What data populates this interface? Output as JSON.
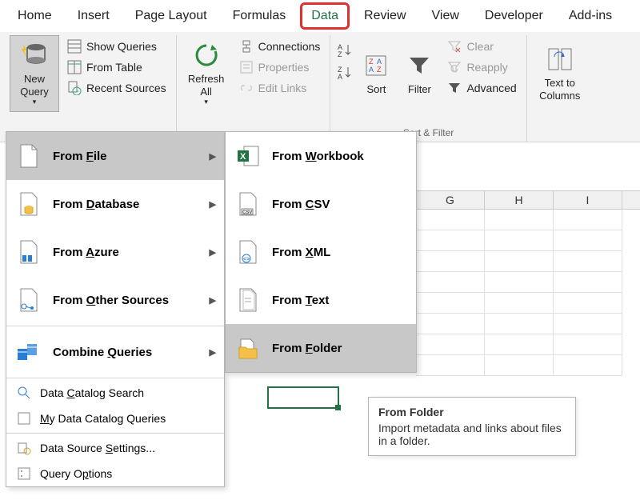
{
  "tabs": {
    "home": "Home",
    "insert": "Insert",
    "page_layout": "Page Layout",
    "formulas": "Formulas",
    "data": "Data",
    "review": "Review",
    "view": "View",
    "developer": "Developer",
    "addins": "Add-ins"
  },
  "ribbon": {
    "new_query": "New Query",
    "show_queries": "Show Queries",
    "from_table": "From Table",
    "recent_sources": "Recent Sources",
    "refresh_all": "Refresh All",
    "connections": "Connections",
    "properties": "Properties",
    "edit_links": "Edit Links",
    "sort": "Sort",
    "filter": "Filter",
    "clear": "Clear",
    "reapply": "Reapply",
    "advanced": "Advanced",
    "sort_filter_group": "Sort & Filter",
    "text_to_columns": "Text to Columns"
  },
  "menu": {
    "from_file": "From File",
    "from_database": "From Database",
    "from_azure": "From Azure",
    "from_other": "From Other Sources",
    "combine_queries": "Combine Queries",
    "data_catalog_search": "Data Catalog Search",
    "my_data_catalog": "My Data Catalog Queries",
    "data_source_settings": "Data Source Settings...",
    "query_options": "Query Options"
  },
  "submenu": {
    "from_workbook": "From Workbook",
    "from_csv": "From CSV",
    "from_xml": "From XML",
    "from_text": "From Text",
    "from_folder": "From Folder"
  },
  "columns": {
    "g": "G",
    "h": "H",
    "i": "I"
  },
  "tooltip": {
    "title": "From Folder",
    "body": "Import metadata and links about files in a folder."
  }
}
